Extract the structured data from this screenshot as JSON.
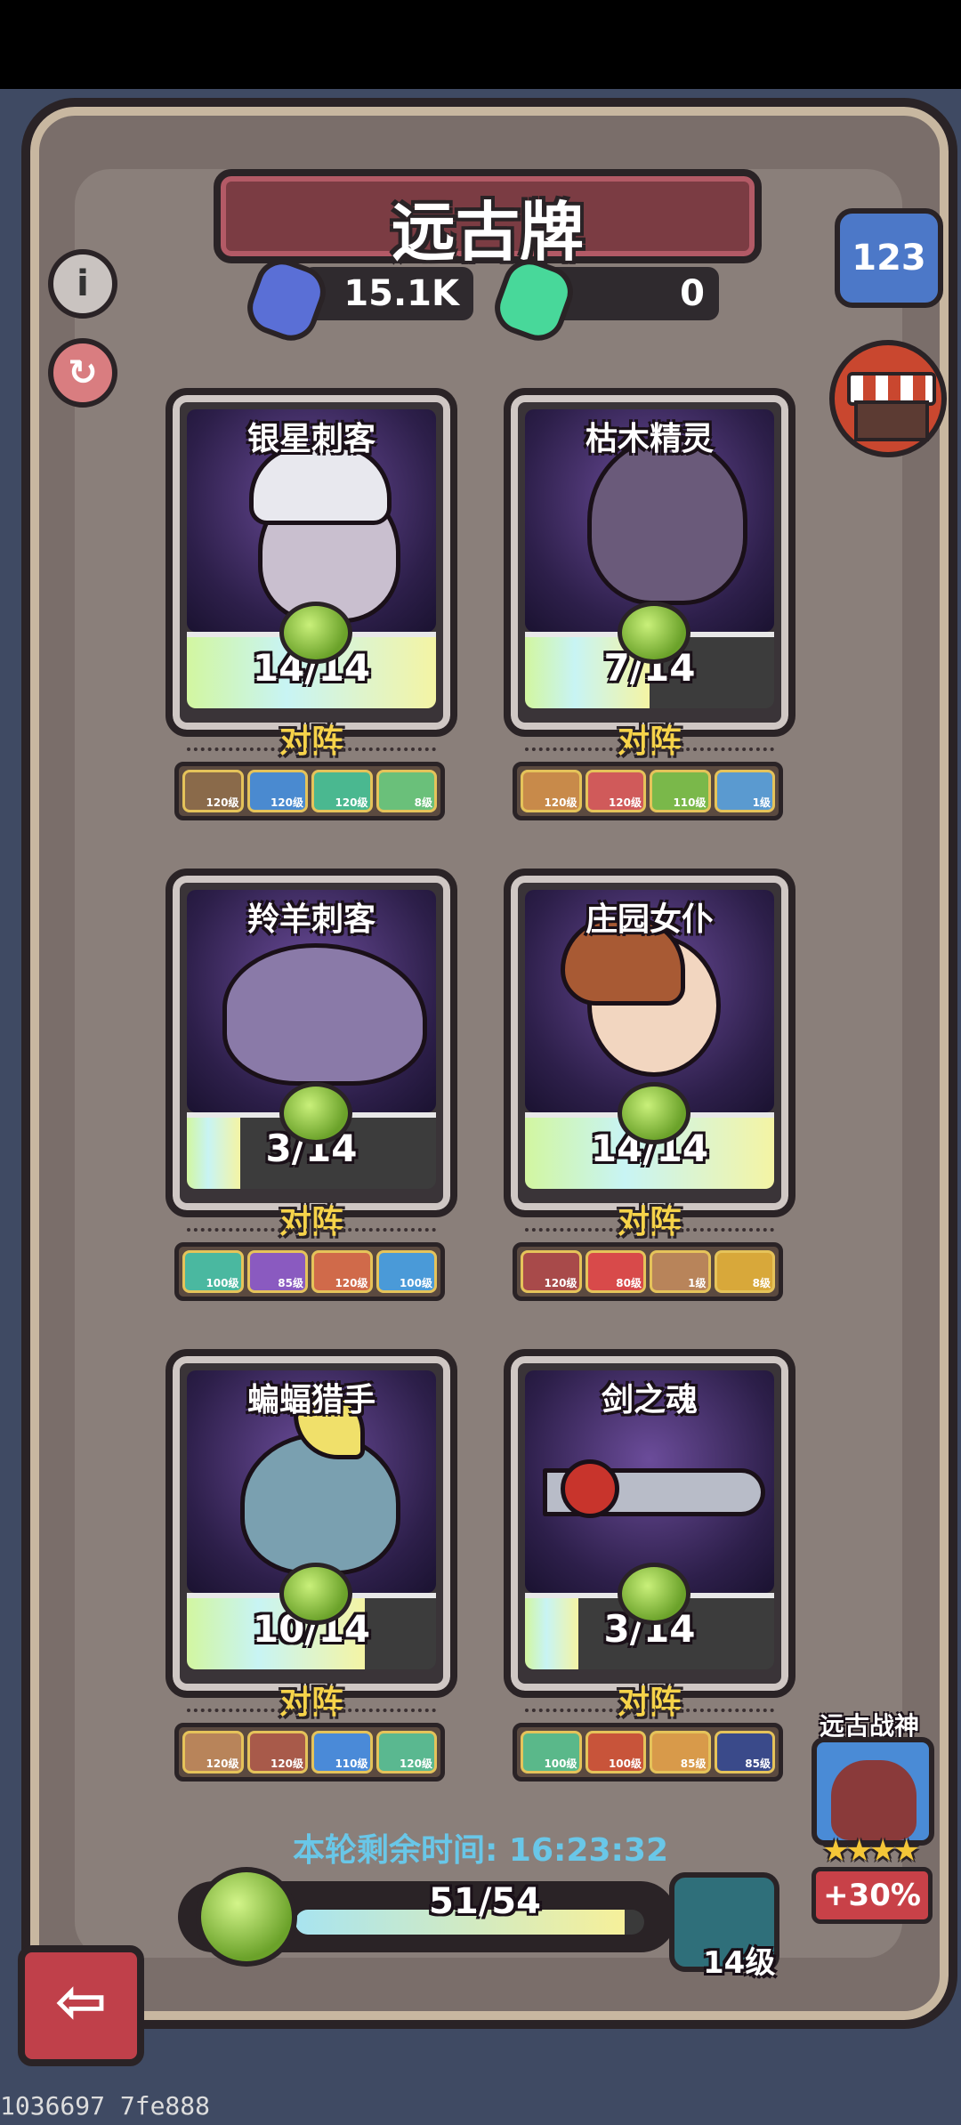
{
  "header": {
    "title": "远古牌"
  },
  "currencies": [
    {
      "icon": "blue-crystal-icon",
      "amount": "15.1K",
      "color": "#5a6fd6"
    },
    {
      "icon": "green-crystal-icon",
      "amount": "0",
      "color": "#48d89a"
    }
  ],
  "side_buttons": {
    "info_icon": "i",
    "rank_label": "123"
  },
  "cards": [
    {
      "name": "银星刺客",
      "count": "14/14",
      "progress": 1.0,
      "lineup_label": "对阵",
      "lineup": [
        "120级",
        "120级",
        "120级",
        "8级"
      ]
    },
    {
      "name": "枯木精灵",
      "count": "7/14",
      "progress": 0.5,
      "lineup_label": "对阵",
      "lineup": [
        "120级",
        "120级",
        "110级",
        "1级"
      ]
    },
    {
      "name": "羚羊刺客",
      "count": "3/14",
      "progress": 0.214,
      "lineup_label": "对阵",
      "lineup": [
        "100级",
        "85级",
        "120级",
        "100级"
      ]
    },
    {
      "name": "庄园女仆",
      "count": "14/14",
      "progress": 1.0,
      "lineup_label": "对阵",
      "lineup": [
        "120级",
        "80级",
        "1级",
        "8级"
      ]
    },
    {
      "name": "蝙蝠猎手",
      "count": "10/14",
      "progress": 0.714,
      "lineup_label": "对阵",
      "lineup": [
        "120级",
        "120级",
        "110级",
        "120级"
      ]
    },
    {
      "name": "剑之魂",
      "count": "3/14",
      "progress": 0.214,
      "lineup_label": "对阵",
      "lineup": [
        "100级",
        "100级",
        "85级",
        "85级"
      ]
    }
  ],
  "timer": {
    "label": "本轮剩余时间:",
    "value": "16:23:32"
  },
  "progress": {
    "text": "51/54",
    "value": 0.944
  },
  "chest": {
    "level": "14级"
  },
  "boss": {
    "label": "远古战神",
    "stars": "★★★★",
    "bonus": "+30%"
  },
  "back": {
    "icon": "back-arrow-icon"
  },
  "watermark": "1036697 7fe888"
}
